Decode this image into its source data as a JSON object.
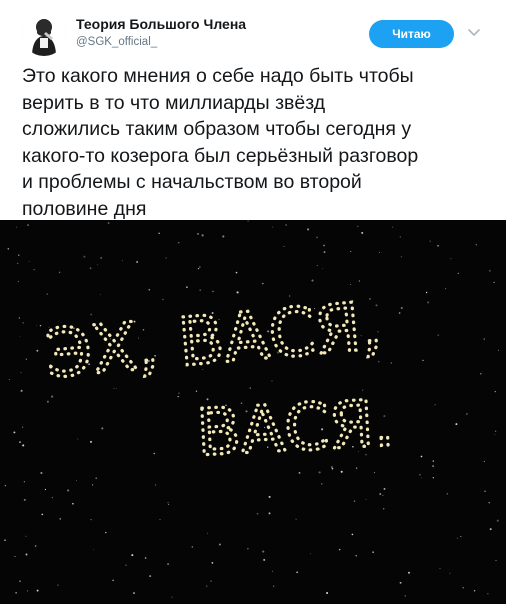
{
  "author": {
    "name": "Теория Большого Члена",
    "handle": "@SGK_official_"
  },
  "follow_label": "Читаю",
  "tweet": {
    "text": "Это какого мнения о себе надо быть чтобы\nверить в то что миллиарды звёзд\nсложились таким образом чтобы сегодня у\nкакого-то козерога был серьёзный разговор\nи проблемы с начальством во второй\nполовине дня"
  },
  "media": {
    "line1": "ЭХ, ВАСЯ,",
    "line2": "ВАСЯ."
  },
  "colors": {
    "accent": "#1da1f2",
    "star": "#f3e9b8",
    "sky": "#050505"
  },
  "icons": [
    "avatar",
    "chevron-down-icon"
  ]
}
